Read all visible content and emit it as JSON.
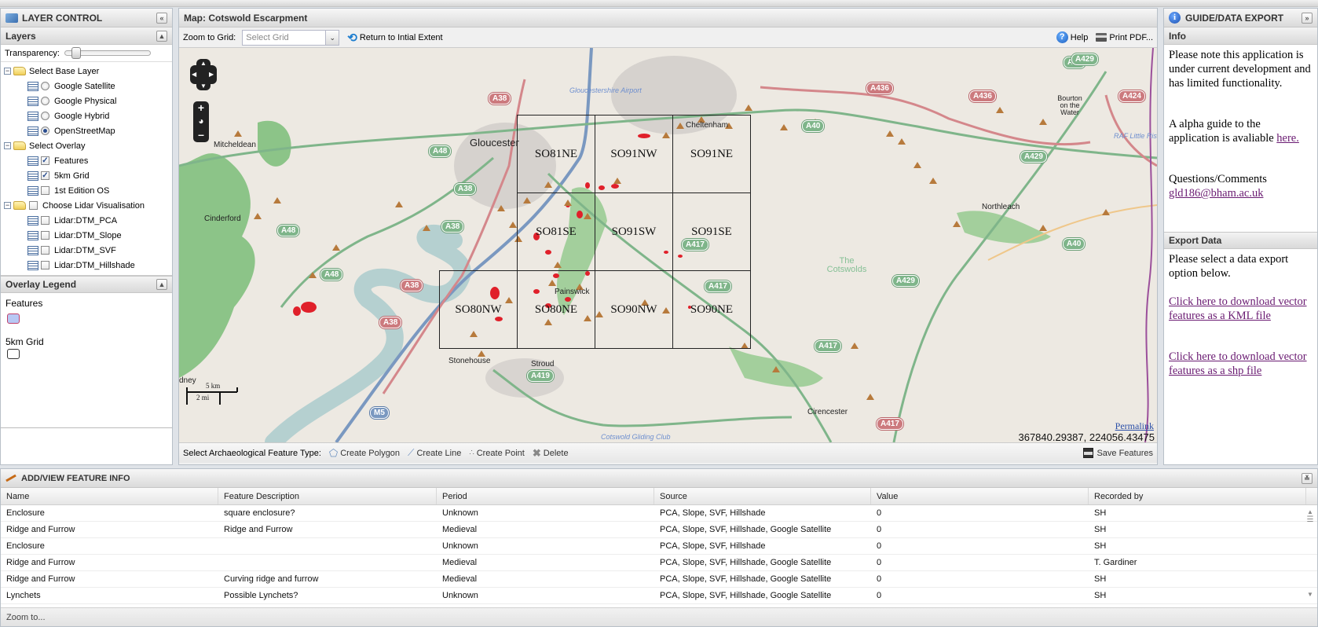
{
  "layer_control": {
    "title": "LAYER CONTROL",
    "collapse_symbol": "«",
    "layers_header": "Layers",
    "transparency_label": "Transparency:",
    "transparency_value": 0.08,
    "base_layer_group": "Select Base Layer",
    "base_layers": [
      {
        "label": "Google Satellite",
        "selected": false
      },
      {
        "label": "Google Physical",
        "selected": false
      },
      {
        "label": "Google Hybrid",
        "selected": false
      },
      {
        "label": "OpenStreetMap",
        "selected": true
      }
    ],
    "overlay_group": "Select Overlay",
    "overlays": [
      {
        "label": "Features",
        "checked": true
      },
      {
        "label": "5km Grid",
        "checked": true
      },
      {
        "label": "1st Edition OS",
        "checked": false
      }
    ],
    "lidar_group": "Choose Lidar Visualisation",
    "lidar_layers": [
      {
        "label": "Lidar:DTM_PCA",
        "checked": false
      },
      {
        "label": "Lidar:DTM_Slope",
        "checked": false
      },
      {
        "label": "Lidar:DTM_SVF",
        "checked": false
      },
      {
        "label": "Lidar:DTM_Hillshade",
        "checked": false
      }
    ],
    "legend_header": "Overlay Legend",
    "legend_items": [
      {
        "label": "Features",
        "swatch_fill": "#b8c8f4",
        "swatch_stroke": "#c0406a"
      },
      {
        "label": "5km Grid",
        "swatch_fill": "#ffffff",
        "swatch_stroke": "#333333",
        "alt_text": "left"
      }
    ]
  },
  "map": {
    "title": "Map: Cotswold Escarpment",
    "zoom_to_grid_label": "Zoom to Grid:",
    "grid_select_placeholder": "Select Grid",
    "return_extent_label": "Return to Intial Extent",
    "help_label": "Help",
    "print_label": "Print PDF...",
    "grid_cells": [
      [
        "SO81NE",
        "SO91NW",
        "SO91NE"
      ],
      [
        "SO81SE",
        "SO91SW",
        "SO91SE"
      ],
      [
        "SO80NW",
        "SO80NE",
        "SO90NW",
        "SO90NE"
      ]
    ],
    "places": {
      "gloucester": "Gloucester",
      "cheltenham": "Cheltenham",
      "mitcheldean": "Mitcheldean",
      "cinderford": "Cinderford",
      "painswick": "Painswick",
      "stonehouse": "Stonehouse",
      "stroud": "Stroud",
      "northleach": "Northleach",
      "bourton": "Bourton on the Water",
      "cirencester": "Cirencester",
      "cotswolds": "The Cotswolds",
      "airport": "Gloucestershire Airport",
      "raf": "RAF Little Rissington",
      "gliding": "Cotswold Gliding Club",
      "lydney": "dney"
    },
    "roads": {
      "a38_1": "A38",
      "a38_2": "A38",
      "a38_3": "A38",
      "a38_4": "A38",
      "a38_5": "A38",
      "a48_1": "A48",
      "a48_2": "A48",
      "a48_3": "A48",
      "a40_1": "A40",
      "a40_2": "A40",
      "a40_3": "A40",
      "a436_1": "A436",
      "a436_2": "A436",
      "a429_1": "A429",
      "a429_2": "A429",
      "a429_3": "A429",
      "a424": "A424",
      "a417_1": "A417",
      "a417_2": "A417",
      "a417_3": "A417",
      "a417_4": "A417",
      "a419": "A419",
      "m5": "M5"
    },
    "scale_km": "5 km",
    "scale_mi": "2 mi",
    "permalink_label": "Permalink",
    "coordinates": "367840.29387, 224056.43475",
    "feature_type_label": "Select Archaeological Feature Type:",
    "create_polygon_label": "Create Polygon",
    "create_line_label": "Create Line",
    "create_point_label": "Create Point",
    "delete_label": "Delete",
    "save_features_label": "Save Features",
    "colors": {
      "land": "#ede9e2",
      "woodland": "#8cc488",
      "water": "#b5d0d0",
      "primary_road": "#7fb58a",
      "trunk_road": "#d4878b",
      "motorway": "#7a98c0",
      "feature_polygon": "#e0202a",
      "grid_line": "#222222"
    }
  },
  "guide": {
    "title": "GUIDE/DATA EXPORT",
    "collapse_symbol": "»",
    "info_header": "Info",
    "note_text": "Please note this application is under current development and has limited functionality.",
    "guide_text": "A alpha guide to the application is avaliable ",
    "guide_link": "here.",
    "questions_label": "Questions/Comments",
    "email": "gld186@bham.ac.uk",
    "export_header": "Export Data",
    "export_text": "Please select a data export option below.",
    "kml_link": "Click here to download vector features as a KML file",
    "shp_link": "Click here to download vector features as a shp file"
  },
  "feature_info": {
    "title": "ADD/VIEW FEATURE INFO",
    "collapse_symbol": "≚",
    "columns": [
      "Name",
      "Feature Description",
      "Period",
      "Source",
      "Value",
      "Recorded by"
    ],
    "rows": [
      [
        "Enclosure",
        "square enclosure?",
        "Unknown",
        "PCA, Slope, SVF, Hillshade",
        "0",
        "SH"
      ],
      [
        "Ridge and Furrow",
        "Ridge and Furrow",
        "Medieval",
        "PCA, Slope, SVF, Hillshade, Google Satellite",
        "0",
        "SH"
      ],
      [
        "Enclosure",
        "",
        "Unknown",
        "PCA, Slope, SVF, Hillshade",
        "0",
        "SH"
      ],
      [
        "Ridge and Furrow",
        "",
        "Medieval",
        "PCA, Slope, SVF, Hillshade, Google Satellite",
        "0",
        "T. Gardiner"
      ],
      [
        "Ridge and Furrow",
        "Curving ridge and furrow",
        "Medieval",
        "PCA, Slope, SVF, Hillshade, Google Satellite",
        "0",
        "SH"
      ],
      [
        "Lynchets",
        "Possible Lynchets?",
        "Unknown",
        "PCA, Slope, SVF, Hillshade, Google Satellite",
        "0",
        "SH"
      ]
    ],
    "footer_label": "Zoom to..."
  }
}
